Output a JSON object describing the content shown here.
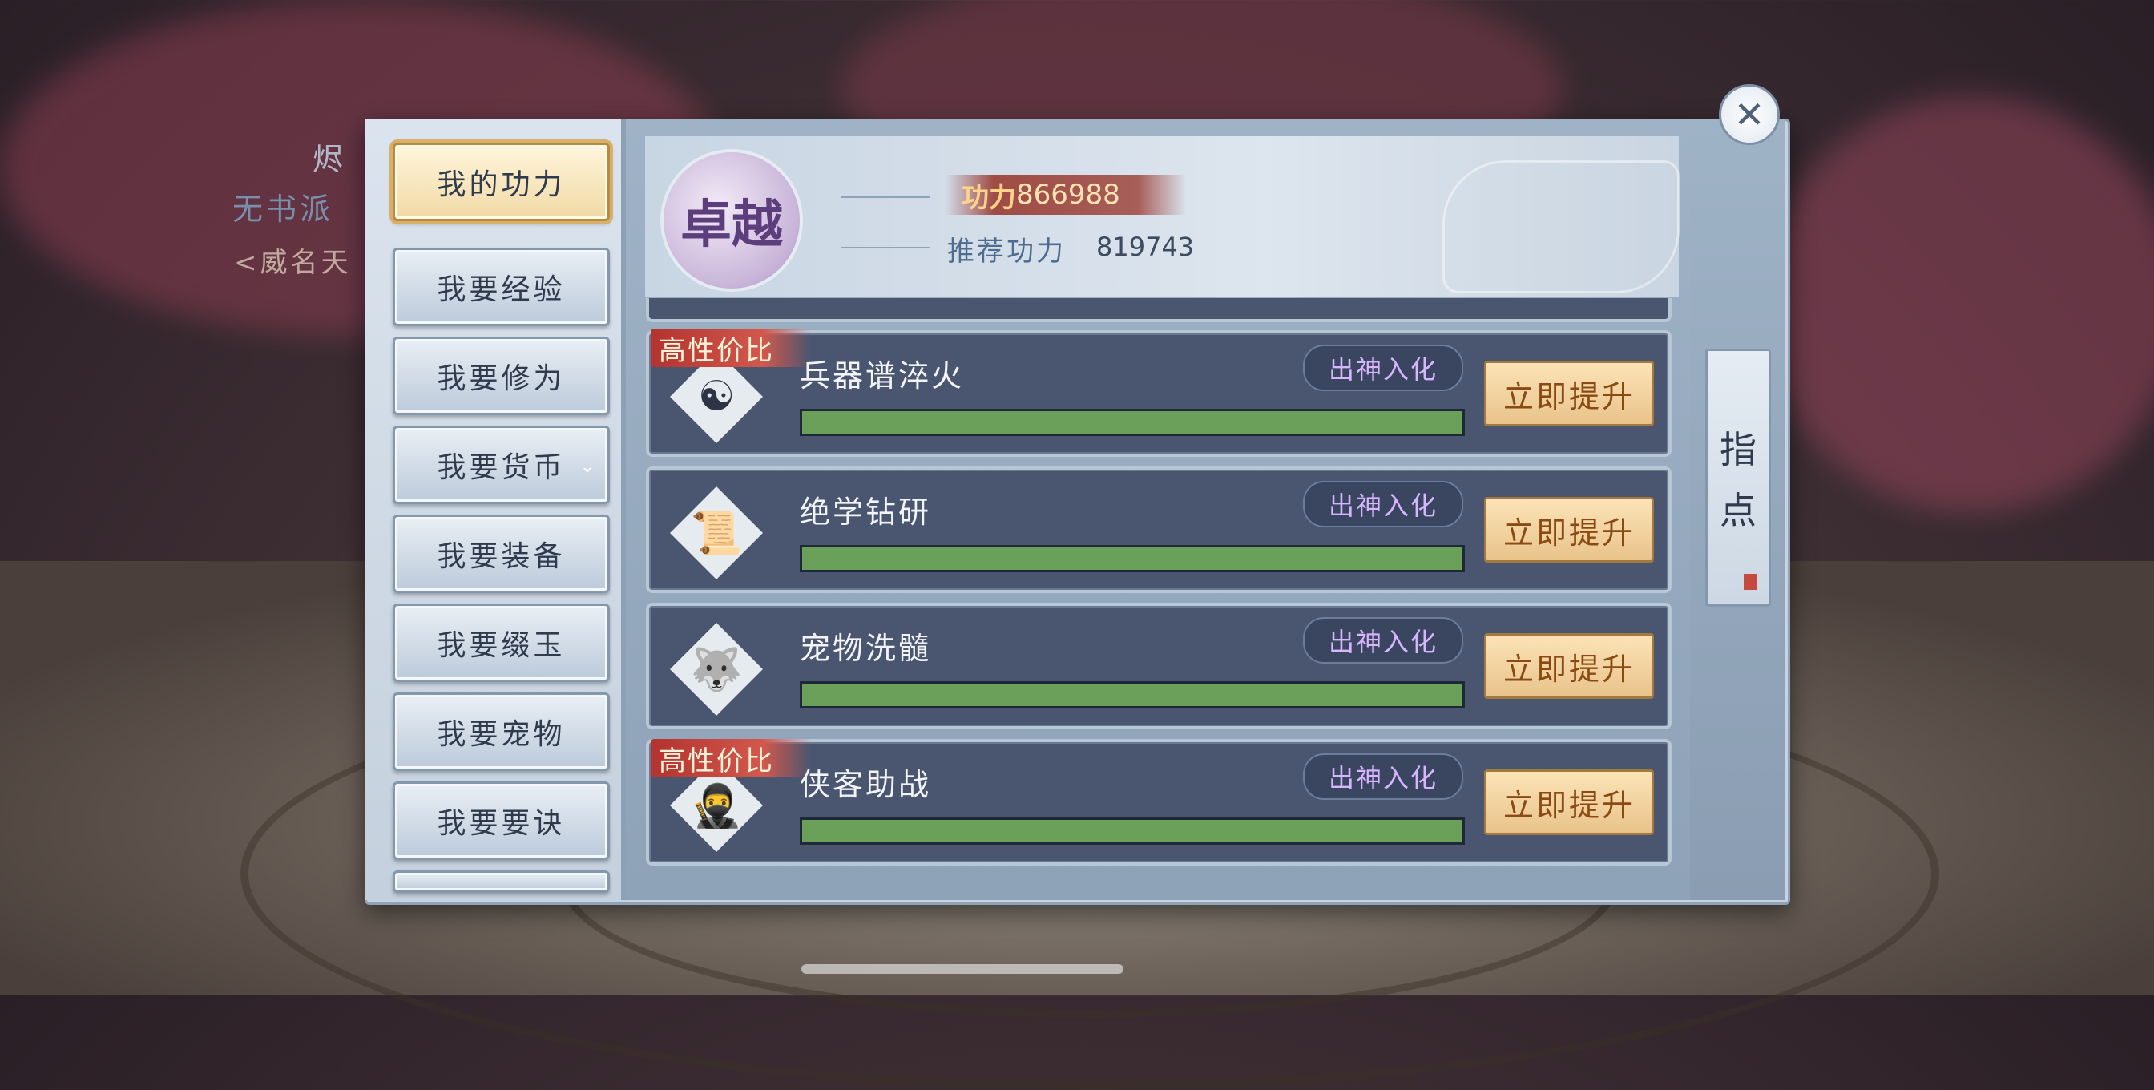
{
  "background": {
    "name_partial": "烬",
    "guild_partial": "无书派",
    "title_partial": "<威名天"
  },
  "sidebar": {
    "items": [
      {
        "label": "我的功力",
        "active": true
      },
      {
        "label": "我要经验"
      },
      {
        "label": "我要修为"
      },
      {
        "label": "我要货币",
        "has_dropdown": true
      },
      {
        "label": "我要装备"
      },
      {
        "label": "我要缀玉"
      },
      {
        "label": "我要宠物"
      },
      {
        "label": "我要要诀"
      }
    ]
  },
  "header": {
    "badge_text": "卓越",
    "power_label": "功力",
    "power_value": "866988",
    "recommended_label": "推荐功力",
    "recommended_value": "819743"
  },
  "rows": [
    {
      "title": "兵器谱淬火",
      "tag": "出神入化",
      "button": "立即提升",
      "hot": "高性价比",
      "icon": "yin-yang-icon",
      "progress": 1.0
    },
    {
      "title": "绝学钻研",
      "tag": "出神入化",
      "button": "立即提升",
      "hot": "",
      "icon": "scroll-icon",
      "progress": 1.0
    },
    {
      "title": "宠物洗髓",
      "tag": "出神入化",
      "button": "立即提升",
      "hot": "",
      "icon": "pet-icon",
      "progress": 1.0
    },
    {
      "title": "侠客助战",
      "tag": "出神入化",
      "button": "立即提升",
      "hot": "高性价比",
      "icon": "companion-icon",
      "progress": 1.0
    }
  ],
  "guide": {
    "char1": "指",
    "char2": "点"
  },
  "close_symbol": "✕",
  "colors": {
    "progress_fill": "#6aa05a",
    "tag_text": "#d8b5ff",
    "hot_tag": "#c2443c"
  }
}
